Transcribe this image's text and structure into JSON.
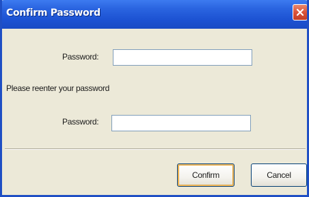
{
  "window": {
    "title": "Confirm Password"
  },
  "form": {
    "password_label": "Password:",
    "password_value": "",
    "reenter_prompt": "Please reenter your password",
    "confirm_password_label": "Password:",
    "confirm_password_value": ""
  },
  "buttons": {
    "confirm_label": "Confirm",
    "cancel_label": "Cancel"
  },
  "colors": {
    "titlebar": "#1c52d2",
    "dialog_background": "#ece9d8",
    "close_button": "#d9533a"
  },
  "icons": {
    "close": "close-icon"
  }
}
